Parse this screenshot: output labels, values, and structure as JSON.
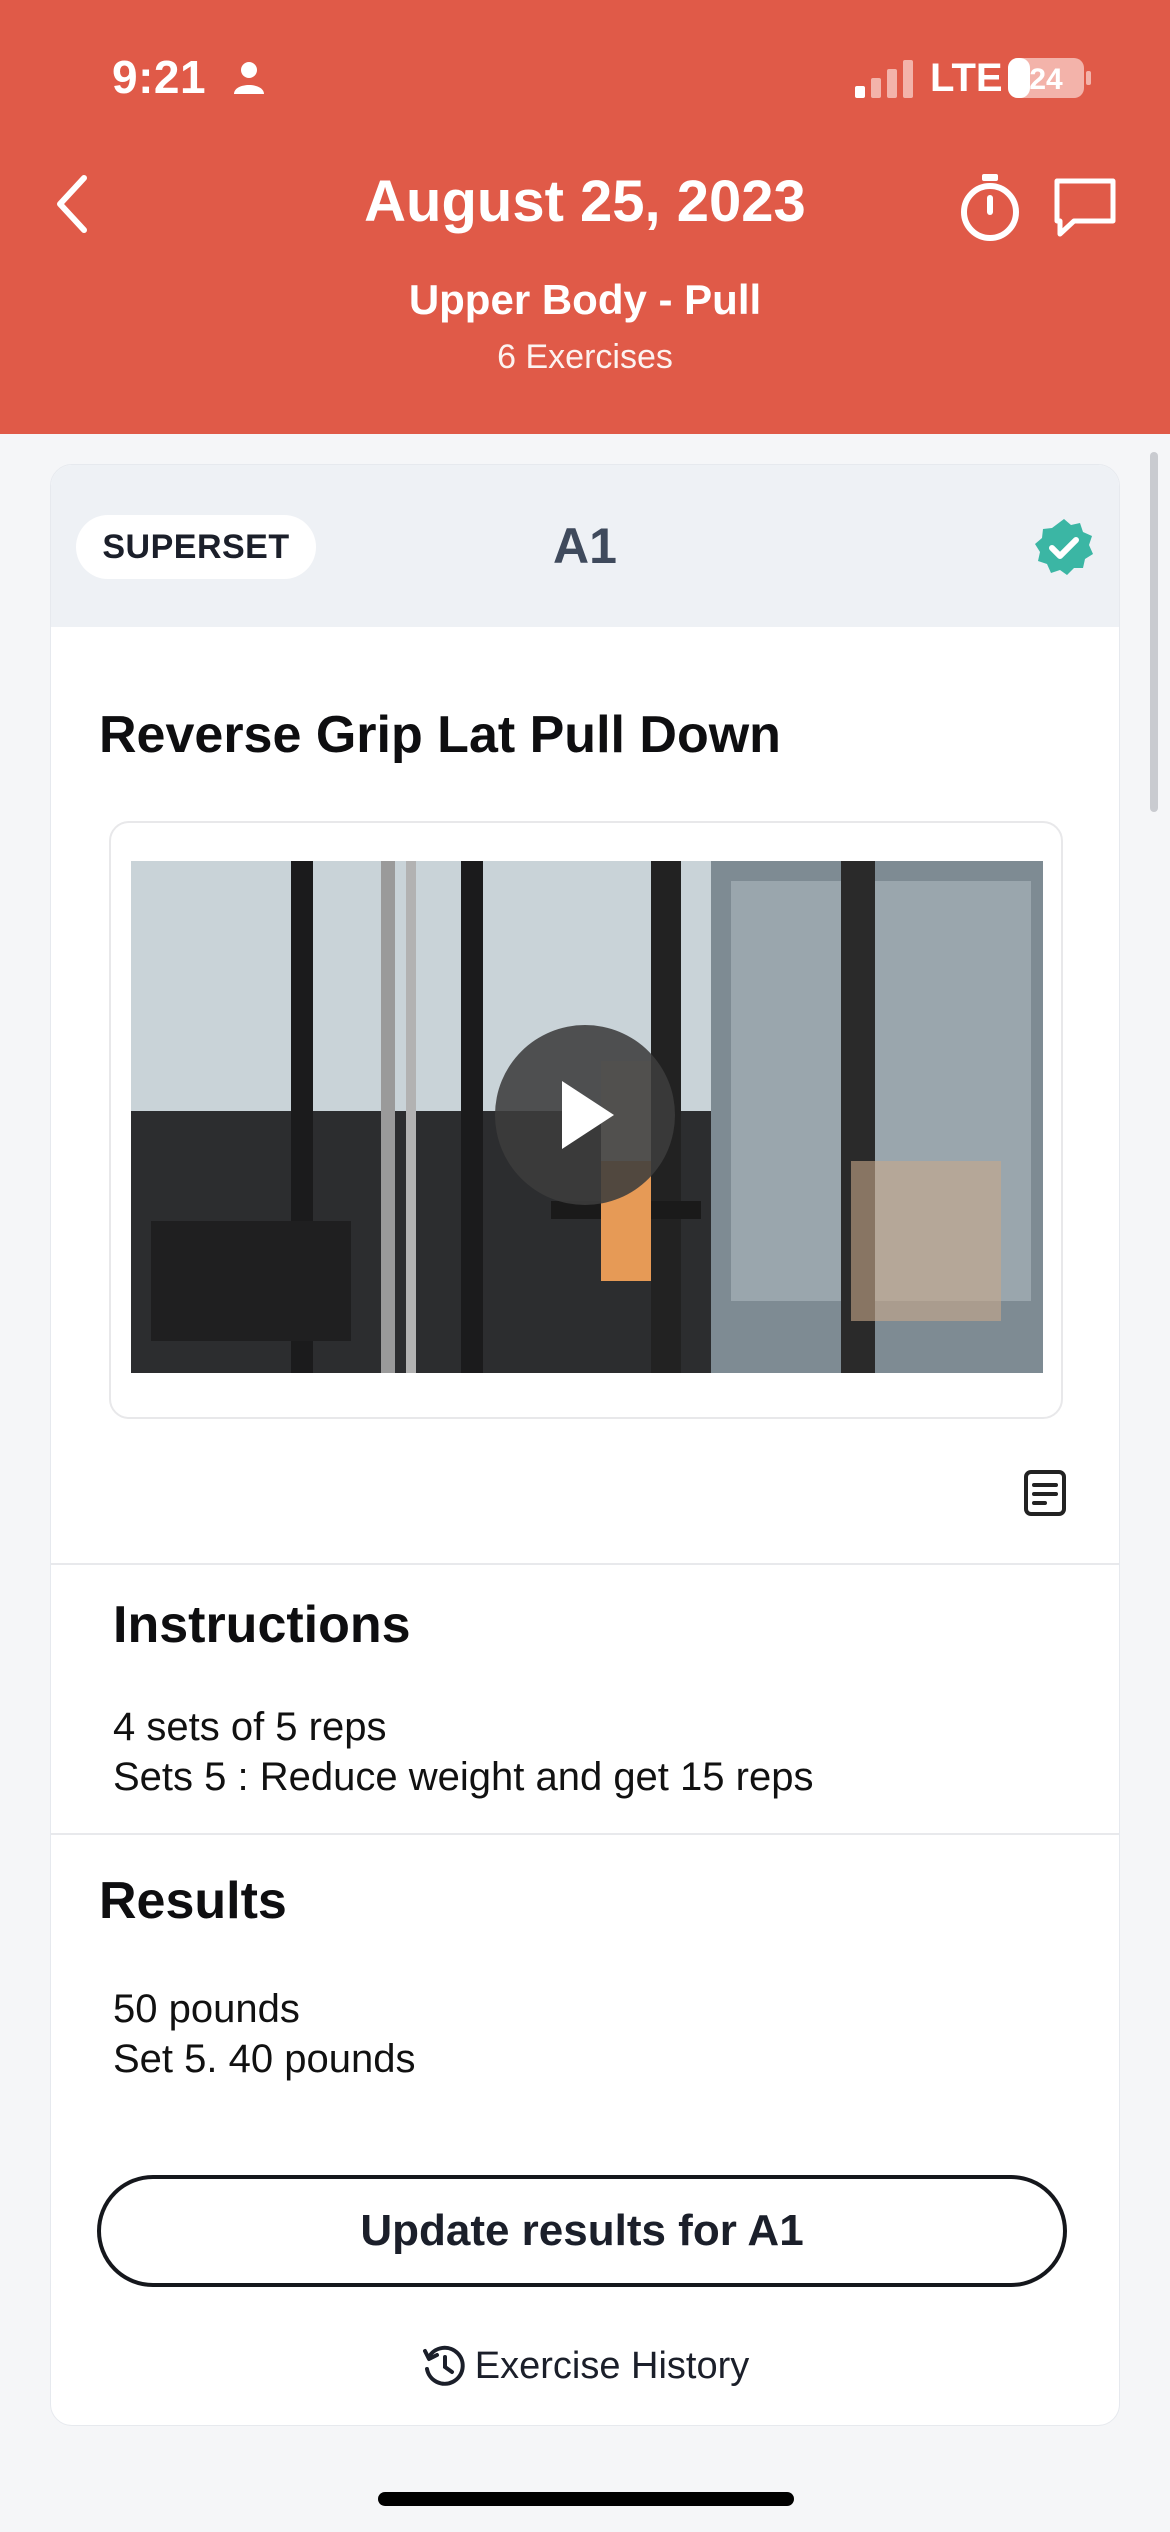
{
  "status_bar": {
    "time": "9:21",
    "network": "LTE",
    "battery": "24"
  },
  "header": {
    "date": "August 25, 2023",
    "workout_name": "Upper Body - Pull",
    "exercise_count": "6 Exercises"
  },
  "card": {
    "badge": "SUPERSET",
    "group": "A1",
    "exercise_title": "Reverse Grip Lat Pull Down",
    "instructions_heading": "Instructions",
    "instructions": [
      "4 sets of 5 reps",
      "Sets 5 : Reduce weight and get 15 reps"
    ],
    "results_heading": "Results",
    "results": [
      "50 pounds",
      "Set 5. 40 pounds"
    ],
    "update_button": "Update results for A1",
    "history_link": "Exercise History"
  },
  "colors": {
    "header": "#e05a48",
    "check": "#3bb6a4"
  },
  "icons": [
    "back-icon",
    "timer-icon",
    "chat-icon",
    "check-badge-icon",
    "play-icon",
    "note-icon",
    "history-icon"
  ]
}
